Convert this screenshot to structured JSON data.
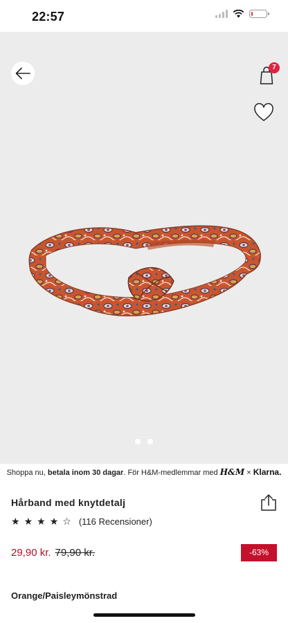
{
  "status_bar": {
    "time": "22:57",
    "battery_level": 0.12,
    "battery_color": "#e53935"
  },
  "header": {
    "bag_count": "7",
    "badge_color": "#e0243e"
  },
  "gallery": {
    "image_count": 2,
    "active_index": 0,
    "background_color": "#ececec"
  },
  "promo": {
    "prefix": "Shoppa nu, ",
    "bold": "betala inom 30 dagar",
    "suffix": ". För H&M-medlemmar med ",
    "hm_logo": "H&M",
    "separator": "×",
    "klarna": "Klarna."
  },
  "product": {
    "title": "Hårband med knytdetalj",
    "rating": 4,
    "rating_max": 5,
    "reviews": "(116 Recensioner)",
    "price_now": "29,90 kr.",
    "price_old": "79,90 kr.",
    "discount": "-63%",
    "color": "Orange/Paisleymönstrad",
    "price_color": "#b20e26",
    "discount_bg": "#c4112b"
  },
  "icons": {
    "back": "arrow-left-icon",
    "bag": "shopping-bag-icon",
    "favorite": "heart-outline-icon",
    "share": "share-icon",
    "star": "star-icon"
  }
}
